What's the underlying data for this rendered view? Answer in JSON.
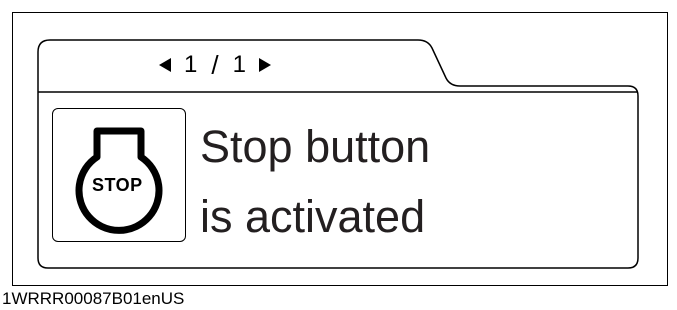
{
  "pager": {
    "current": "1",
    "separator": "/",
    "total": "1",
    "prev_icon": "triangle-left-icon",
    "next_icon": "triangle-right-icon"
  },
  "icon": {
    "name": "stop-button-icon",
    "label": "STOP"
  },
  "message": {
    "line1": "Stop button",
    "line2": "is activated"
  },
  "footer": {
    "code": "1WRRR00087B01enUS"
  }
}
